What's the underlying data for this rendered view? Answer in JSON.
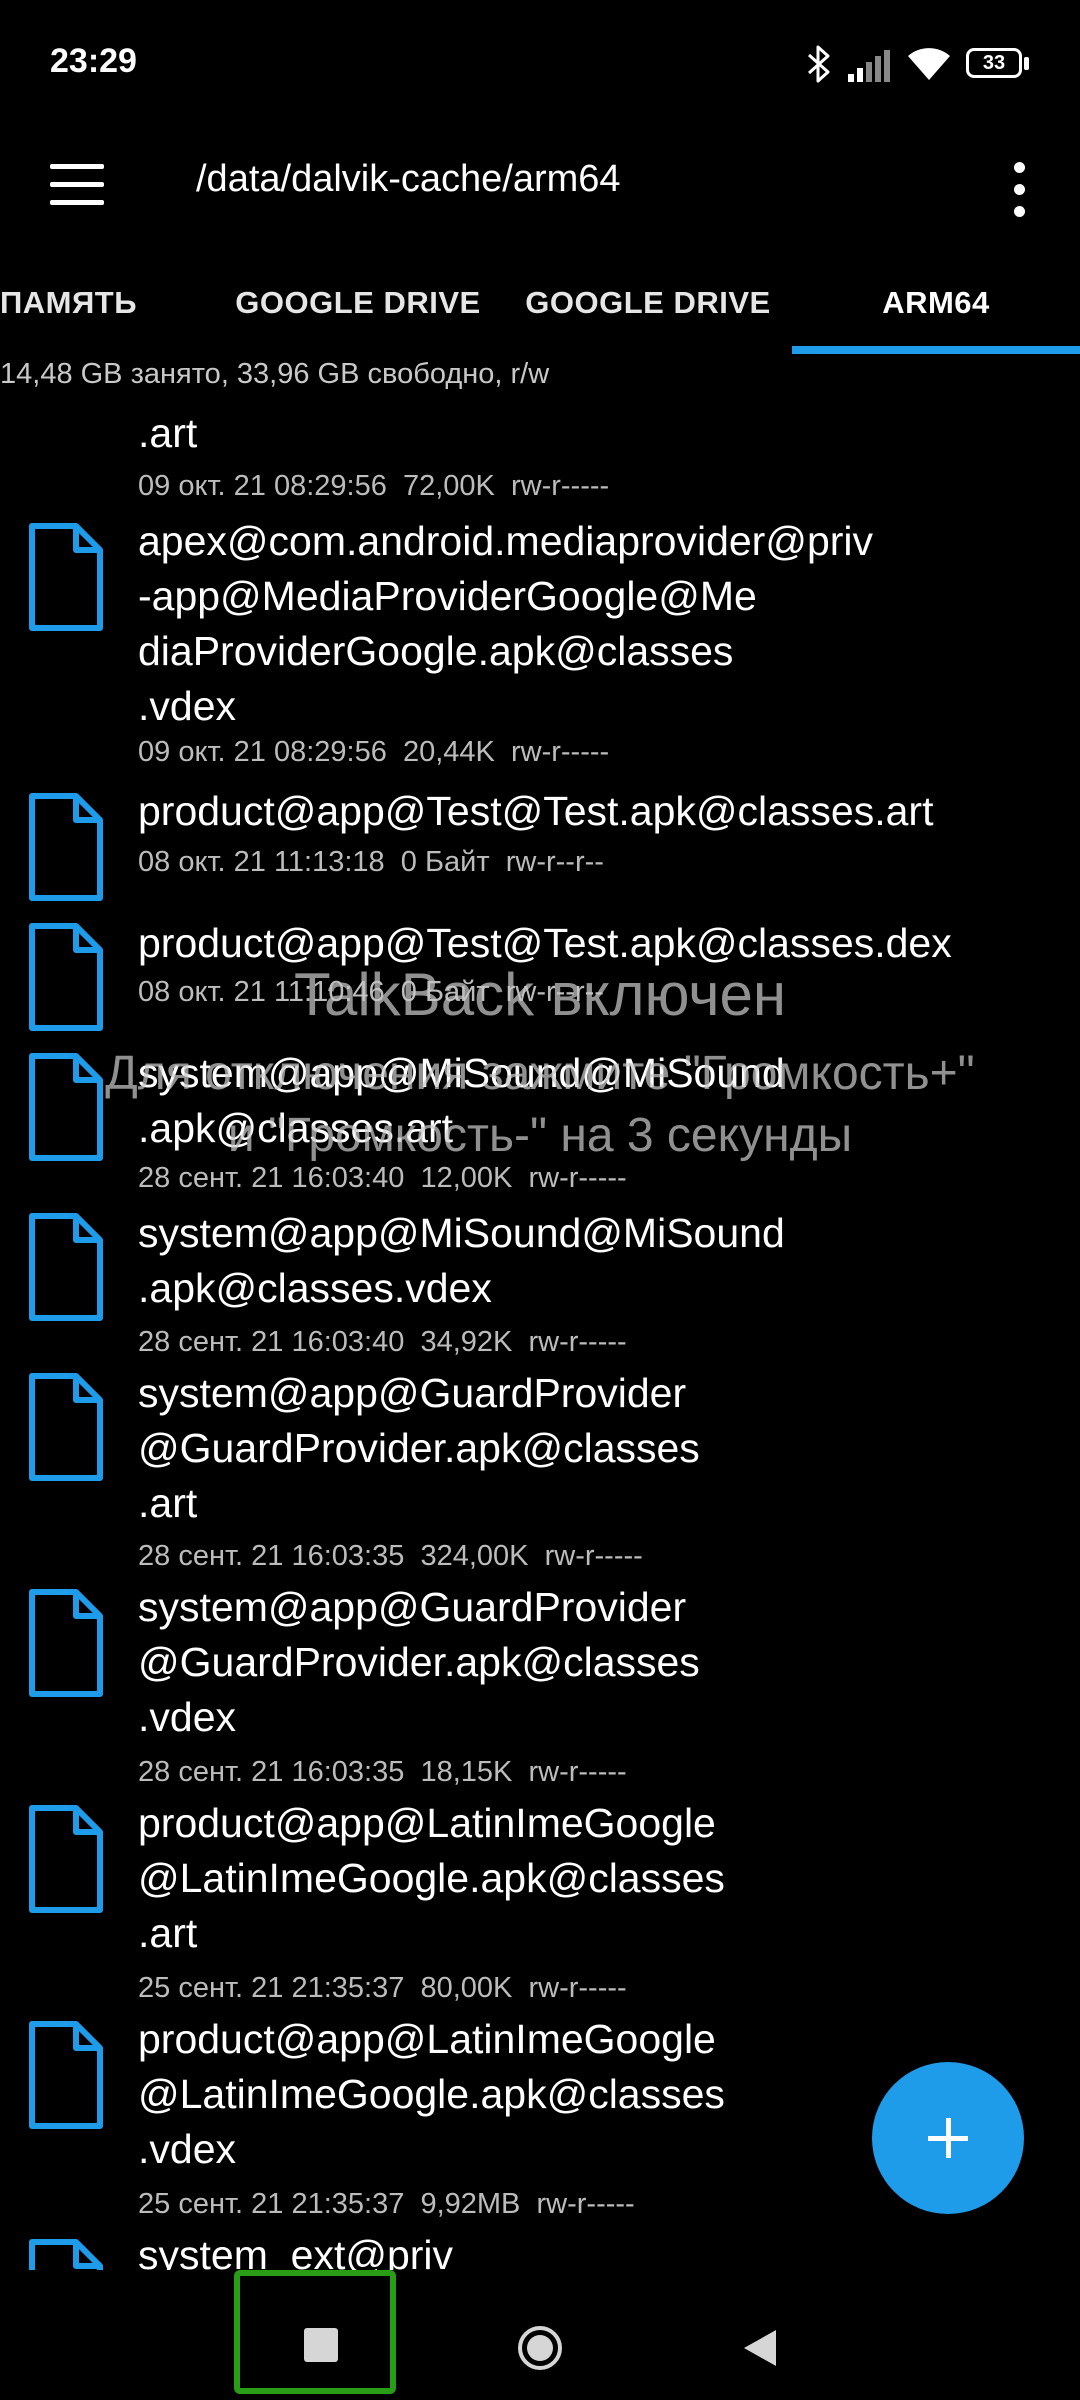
{
  "status_bar": {
    "time": "23:29",
    "icons": [
      "bluetooth-icon",
      "signal-icon",
      "wifi-icon",
      "battery-icon"
    ],
    "battery_level": "33"
  },
  "app_bar": {
    "path": "/data/dalvik-cache/arm64",
    "menu_icon": "hamburger-menu-icon",
    "overflow_icon": "more-vert-icon"
  },
  "tabs": [
    {
      "label": "ПАМЯТЬ",
      "active": false
    },
    {
      "label": "GOOGLE DRIVE",
      "active": false
    },
    {
      "label": "GOOGLE DRIVE",
      "active": false
    },
    {
      "label": "ARM64",
      "active": true
    }
  ],
  "storage_info": "14,48 GB занято, 33,96 GB свободно, r/w",
  "files": [
    {
      "name": ".art",
      "meta": "09 окт. 21 08:29:56  72,00K  rw-r-----"
    },
    {
      "name": "apex@com.android.mediaprovider@priv\n-app@MediaProviderGoogle@Me\ndiaProviderGoogle.apk@classes\n.vdex",
      "meta": "09 окт. 21 08:29:56  20,44K  rw-r-----"
    },
    {
      "name": "product@app@Test@Test.apk@classes.art",
      "meta": "08 окт. 21 11:13:18  0 Байт  rw-r--r--"
    },
    {
      "name": "product@app@Test@Test.apk@classes.dex",
      "meta": "08 окт. 21 11:10:46  0 Байт  rw-r--r--"
    },
    {
      "name": "system@app@MiSound@MiSound\n.apk@classes.art",
      "meta": "28 сент. 21 16:03:40  12,00K  rw-r-----"
    },
    {
      "name": "system@app@MiSound@MiSound\n.apk@classes.vdex",
      "meta": "28 сент. 21 16:03:40  34,92K  rw-r-----"
    },
    {
      "name": "system@app@GuardProvider\n@GuardProvider.apk@classes\n.art",
      "meta": "28 сент. 21 16:03:35  324,00K  rw-r-----"
    },
    {
      "name": "system@app@GuardProvider\n@GuardProvider.apk@classes\n.vdex",
      "meta": "28 сент. 21 16:03:35  18,15K  rw-r-----"
    },
    {
      "name": "product@app@LatinImeGoogle\n@LatinImeGoogle.apk@classes\n.art",
      "meta": "25 сент. 21 21:35:37  80,00K  rw-r-----"
    },
    {
      "name": "product@app@LatinImeGoogle\n@LatinImeGoogle.apk@classes\n.vdex",
      "meta": "25 сент. 21 21:35:37  9,92MB  rw-r-----"
    },
    {
      "name": "system_ext@priv",
      "meta": ""
    }
  ],
  "talkback": {
    "title": "TalkBack включен",
    "hint": "Для отключения зажмите \"Громкость+\"\nи \"Громкость-\" на 3 секунды"
  },
  "fab_icon": "plus-icon",
  "nav_bar": {
    "recents_icon": "recents-square-icon",
    "home_icon": "home-circle-icon",
    "back_icon": "back-triangle-icon"
  },
  "colors": {
    "accent": "#1e9be9",
    "background": "#000000",
    "highlight_border": "#2a9d16"
  }
}
